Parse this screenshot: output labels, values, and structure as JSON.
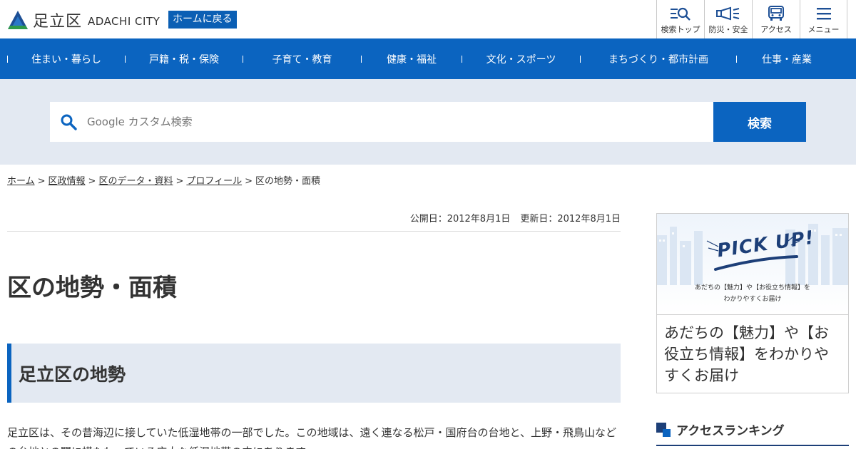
{
  "header": {
    "logo_jp": "足立区",
    "logo_en": "ADACHI CITY",
    "home_button": "ホームに戻る",
    "util_nav": [
      {
        "icon": "search-top-icon",
        "label": "検索トップ"
      },
      {
        "icon": "megaphone-icon",
        "label": "防災・安全"
      },
      {
        "icon": "bus-icon",
        "label": "アクセス"
      },
      {
        "icon": "menu-icon",
        "label": "メニュー"
      }
    ]
  },
  "gnav": {
    "items": [
      "住まい・暮らし",
      "戸籍・税・保険",
      "子育て・教育",
      "健康・福祉",
      "文化・スポーツ",
      "まちづくり・都市計画",
      "仕事・産業"
    ]
  },
  "search": {
    "placeholder": "Google カスタム検索",
    "button": "検索"
  },
  "breadcrumb": {
    "items": [
      "ホーム",
      "区政情報",
      "区のデータ・資料",
      "プロフィール"
    ],
    "current": "区の地勢・面積",
    "separator": ">"
  },
  "main": {
    "published": "公開日：2012年8月1日",
    "updated": "更新日：2012年8月1日",
    "title": "区の地勢・面積",
    "section_heading": "足立区の地勢",
    "body": "足立区は、その昔海辺に接していた低湿地帯の一部でした。この地域は、遠く連なる松戸・国府台の台地と、上野・飛鳥山などの台地との間に横たわっている広大な低湿地帯の中にあります。"
  },
  "sidebar": {
    "pickup_logo": "PICK UP!",
    "pickup_banner_line1": "あだちの【魅力】や【お役立ち情報】を",
    "pickup_banner_line2": "わかりやすくお届け",
    "pickup_caption": "あだちの【魅力】や【お役立ち情報】をわかりやすくお届け",
    "ranking_title": "アクセスランキング"
  },
  "colors": {
    "brand_blue": "#0b64c0",
    "light_blue_bg": "#e3e9f2",
    "navy": "#1d3f78"
  }
}
